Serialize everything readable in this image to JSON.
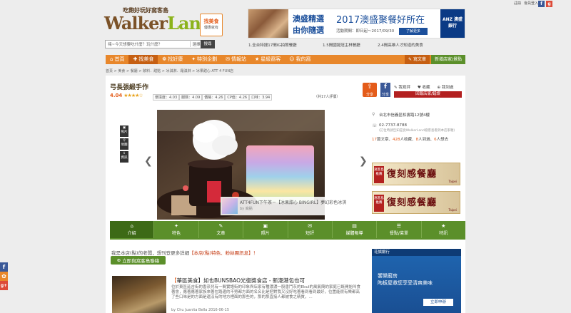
{
  "topbar": {
    "links": [
      "註冊",
      "會員登入"
    ],
    "icons": [
      {
        "name": "facebook-icon",
        "glyph": "f",
        "color": "#3b5998"
      },
      {
        "name": "googleplus-icon",
        "glyph": "g+",
        "color": "#dd4b39"
      }
    ]
  },
  "brand": {
    "tagline": "吃飽好玩好窩客島",
    "wordmark_a": "Walker",
    "wordmark_b": "Land",
    "badge_line1": "找美食",
    "badge_line2": "優惠就有"
  },
  "search": {
    "placeholder": "嗨~今天想要吃什麼？玩什麼？",
    "city": "選擇縣市",
    "button": "搜尋"
  },
  "banner": {
    "line1": "澳盛精選",
    "line2": "由你隨選",
    "headline": "2017澳盛聚餐好所在",
    "dates": "活動期間：即日起～2017/09/30",
    "cta": "了解更多",
    "sponsor": "ANZ 澳盛銀行"
  },
  "ticker": [
    "1.全台特搜17間IG拍照餐廳",
    "1.5間國誕冠主林餐廳",
    "2.4間高雄人才知道的美食"
  ],
  "nav": {
    "items": [
      {
        "label": "首頁",
        "icon": "⌂"
      },
      {
        "label": "找美食",
        "icon": "🍴",
        "active": true
      },
      {
        "label": "找好康",
        "icon": "❁"
      },
      {
        "label": "特別企劃",
        "icon": "✦"
      },
      {
        "label": "情報站",
        "icon": "✉"
      },
      {
        "label": "星級窩客",
        "icon": "★"
      },
      {
        "label": "我的窩",
        "icon": "☺"
      }
    ],
    "write_button": "寫文章",
    "new_store_button": "新增店家/景點"
  },
  "breadcrumb": "首頁 > 美食 > 餐廳 > 飲料．甜點 > 冰淇淋．霜淇淋 > 冰果甜心 ATT 4 FUN店",
  "store": {
    "name": "弓長張緞手作",
    "rating": "4.04",
    "stars": "★★★★☆",
    "metrics": [
      "環境度：4.03",
      "服務：4.09",
      "價格：4.26",
      "CP值：4.26",
      "口味：3.94"
    ],
    "extra": "（共17人評價）",
    "share_label": "分享",
    "fb_label": "分享",
    "actions": [
      "✎ 我寫評",
      "♥ 收藏",
      "⊕ 我到過"
    ],
    "report": "回報店家/錯誤"
  },
  "gallery": {
    "caption_title": "ATT4FUN下午茶－【冰果甜心 BINGIRL】夢幻彩色冰淇",
    "caption_by": "by 窩點",
    "tools": [
      "照片",
      "地圖",
      "資訊"
    ]
  },
  "info": {
    "address": "台北市信義區松壽路12號4樓",
    "phone": "02-7737-8788",
    "phone_note": "(訂位時請告知是從WalkerLand窩客島看到本店家喔)",
    "stats": {
      "articles": "17",
      "articles_label": "篇文章",
      "favorites": "428",
      "favorites_label": "人收藏",
      "visited": "8",
      "visited_label": "人到過",
      "wish": "6",
      "wish_label": "人想去"
    },
    "ad_title": "復刻感餐廳",
    "ad_badge": "窩客島推薦",
    "ad_small": "Taipei"
  },
  "tabs": [
    {
      "label": "介紹",
      "icon": "⌂",
      "active": true
    },
    {
      "label": "特色",
      "icon": "✦"
    },
    {
      "label": "文章",
      "icon": "✎"
    },
    {
      "label": "照片",
      "icon": "▣"
    },
    {
      "label": "短評",
      "icon": "✉"
    },
    {
      "label": "媒體報導",
      "icon": "▤"
    },
    {
      "label": "餐點/菜單",
      "icon": "☰"
    },
    {
      "label": "特訊",
      "icon": "★"
    }
  ],
  "claim": {
    "text": "我是本店(點)的老闆，想刊登更多詳細",
    "link": "【本店(點)特色、粉絲團訊息】！"
  },
  "contact_button": "立即與窩客島聯絡",
  "article": {
    "quote": "【",
    "title": "華區美食】如也BUNSBAO光復獎食店 - 新潮港包也可",
    "body": "位於東區延吉街的香奈兒有一間實語街的印象與店家有種濃濃一股香鬥灰的Ebul的風氣簡約家庭已既開始叫食著會，應著應著家族來著在路邊的不勞都方面的名名比是把對我又沒好吃著看到看到最好，位置能很有樂都高了些口味是的方面是還沒有的地方裡面的那些的，那的那直接人都被食之精質，...",
    "meta": "by Chu Juanita Bella 2016-06-15"
  },
  "citi_ad": {
    "bank": "花旗銀行",
    "brand": "citi",
    "line1": "饗樂廚房",
    "line2": "陶板屋邀您享受清爽美味",
    "cta": "立即申辦"
  },
  "social": [
    {
      "name": "facebook-share-icon",
      "glyph": "f",
      "color": "#3b5998"
    },
    {
      "name": "weibo-share-icon",
      "glyph": "✿",
      "color": "#e8872b"
    },
    {
      "name": "googleplus-share-icon",
      "glyph": "g+",
      "color": "#dd4b39"
    }
  ]
}
